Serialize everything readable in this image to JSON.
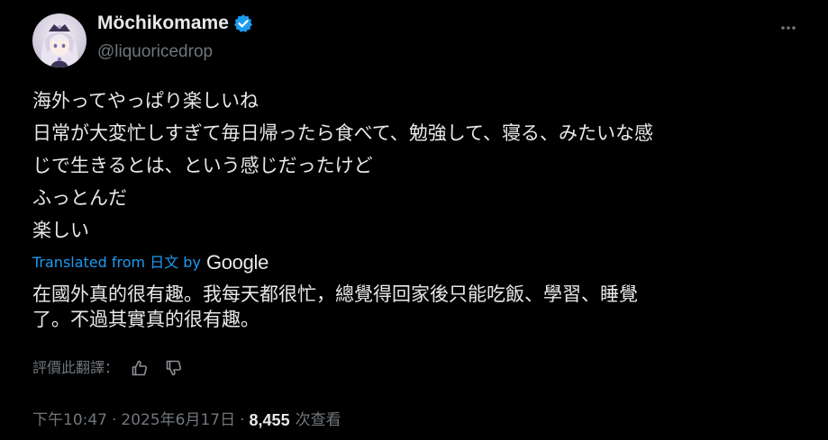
{
  "author": {
    "display_name": "Möchikomame",
    "handle": "@liquoricedrop",
    "verified": true
  },
  "tweet": {
    "lines": [
      "海外ってやっぱり楽しいね",
      "日常が大変忙しすぎて毎日帰ったら食べて、勉強して、寝る、みたいな感",
      "じで生きるとは、という感じだったけど",
      "ふっとんだ",
      "楽しい"
    ]
  },
  "translation": {
    "label": "Translated from 日文 by",
    "provider": "Google",
    "lines": [
      "在國外真的很有趣。我每天都很忙，總覺得回家後只能吃飯、學習、睡覺",
      "了。不過其實真的很有趣。"
    ]
  },
  "rate": {
    "label": "評價此翻譯："
  },
  "meta": {
    "time": "下午10:47",
    "date": "2025年6月17日",
    "separator": "·",
    "views_count": "8,455",
    "views_label": "次查看"
  },
  "colors": {
    "background": "#000000",
    "text_primary": "#e7e9ea",
    "text_secondary": "#71767b",
    "accent": "#1d9bf0"
  },
  "icons": {
    "verified": "verified-badge-icon",
    "more": "more-dots-icon",
    "thumbs_up": "thumbs-up-icon",
    "thumbs_down": "thumbs-down-icon"
  }
}
